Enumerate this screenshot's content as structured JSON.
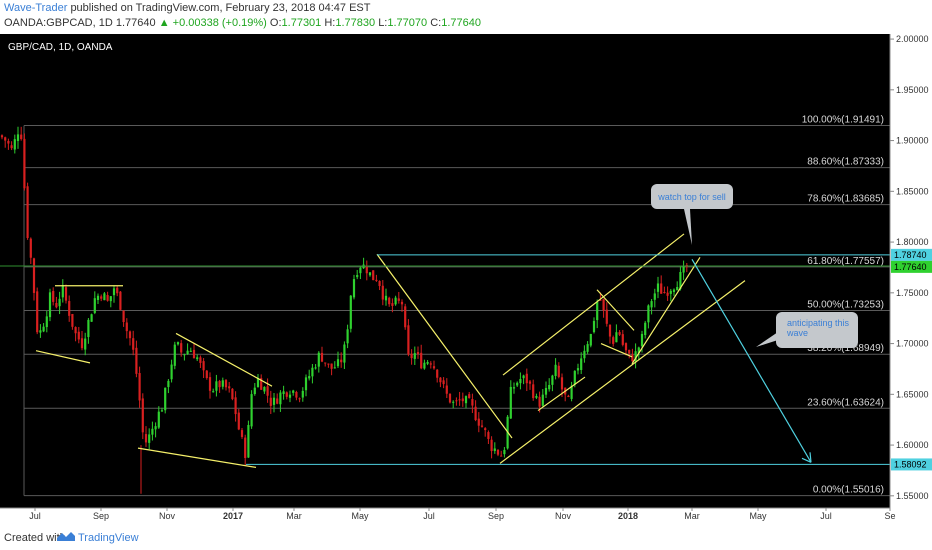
{
  "header": {
    "author": "Wave-Trader",
    "published": "published on TradingView.com, February 23, 2018 04:47 EST",
    "symbol": "OANDA:GBPCAD, 1D",
    "last": "1.77640",
    "change": "+0.00338 (+0.19%)",
    "o_label": "O:",
    "o_value": "1.77301",
    "h_label": "H:",
    "h_value": "1.77830",
    "l_label": "L:",
    "l_value": "1.77070",
    "c_label": "C:",
    "c_value": "1.77640"
  },
  "footer": {
    "created_with": "Created with",
    "brand": "TradingView"
  },
  "colors": {
    "bg": "#000000",
    "bull": "#2fd12f",
    "bear": "#d92020",
    "fib": "#5a5a5a",
    "trend": "#f5f06a",
    "cyan": "#4fd1e0",
    "note_bg": "#c4c8cc"
  },
  "chart_data": {
    "type": "candlestick",
    "symbol_label": "GBP/CAD, 1D, OANDA",
    "x_ticks": [
      "Jul",
      "Sep",
      "Nov",
      "2017",
      "Mar",
      "May",
      "Jul",
      "Sep",
      "Nov",
      "2018",
      "Mar",
      "May",
      "Jul",
      "Se"
    ],
    "y_ticks": [
      "2.00000",
      "1.95000",
      "1.90000",
      "1.85000",
      "1.80000",
      "1.75000",
      "1.70000",
      "1.65000",
      "1.60000",
      "1.55000"
    ],
    "ylim": [
      1.538,
      2.005
    ],
    "price_badges": [
      {
        "label": "1.78740",
        "value": 1.7874,
        "color": "#4fd1e0"
      },
      {
        "label": "1.77640",
        "value": 1.7764,
        "color": "#2fd12f"
      },
      {
        "label": "1.58092",
        "value": 1.58092,
        "color": "#4fd1e0"
      }
    ],
    "fib_levels": [
      {
        "label": "100.00%(1.91491)",
        "value": 1.91491
      },
      {
        "label": "88.60%(1.87333)",
        "value": 1.87333
      },
      {
        "label": "78.60%(1.83685)",
        "value": 1.83685
      },
      {
        "label": "61.80%(1.77557)",
        "value": 1.77557
      },
      {
        "label": "50.00%(1.73253)",
        "value": 1.73253
      },
      {
        "label": "38.20%(1.68949)",
        "value": 1.68949
      },
      {
        "label": "23.60%(1.63624)",
        "value": 1.63624
      },
      {
        "label": "0.00%(1.55016)",
        "value": 1.55016
      }
    ],
    "price_path": [
      [
        0,
        1.905
      ],
      [
        6,
        1.9
      ],
      [
        12,
        1.89
      ],
      [
        18,
        1.91
      ],
      [
        22,
        1.905
      ],
      [
        26,
        1.82
      ],
      [
        32,
        1.775
      ],
      [
        38,
        1.705
      ],
      [
        45,
        1.725
      ],
      [
        50,
        1.745
      ],
      [
        57,
        1.738
      ],
      [
        62,
        1.755
      ],
      [
        68,
        1.735
      ],
      [
        75,
        1.71
      ],
      [
        82,
        1.7
      ],
      [
        88,
        1.72
      ],
      [
        95,
        1.745
      ],
      [
        102,
        1.75
      ],
      [
        108,
        1.74
      ],
      [
        114,
        1.755
      ],
      [
        120,
        1.74
      ],
      [
        126,
        1.715
      ],
      [
        132,
        1.7
      ],
      [
        138,
        1.66
      ],
      [
        144,
        1.6
      ],
      [
        150,
        1.61
      ],
      [
        156,
        1.625
      ],
      [
        163,
        1.64
      ],
      [
        170,
        1.675
      ],
      [
        176,
        1.7
      ],
      [
        182,
        1.69
      ],
      [
        190,
        1.695
      ],
      [
        198,
        1.685
      ],
      [
        205,
        1.665
      ],
      [
        212,
        1.655
      ],
      [
        220,
        1.66
      ],
      [
        228,
        1.655
      ],
      [
        234,
        1.64
      ],
      [
        240,
        1.61
      ],
      [
        246,
        1.59
      ],
      [
        252,
        1.655
      ],
      [
        258,
        1.665
      ],
      [
        265,
        1.655
      ],
      [
        272,
        1.64
      ],
      [
        280,
        1.65
      ],
      [
        290,
        1.655
      ],
      [
        300,
        1.65
      ],
      [
        310,
        1.67
      ],
      [
        320,
        1.69
      ],
      [
        330,
        1.675
      ],
      [
        340,
        1.68
      ],
      [
        346,
        1.7
      ],
      [
        350,
        1.745
      ],
      [
        355,
        1.77
      ],
      [
        360,
        1.778
      ],
      [
        366,
        1.775
      ],
      [
        372,
        1.765
      ],
      [
        378,
        1.765
      ],
      [
        384,
        1.745
      ],
      [
        390,
        1.735
      ],
      [
        396,
        1.74
      ],
      [
        402,
        1.74
      ],
      [
        408,
        1.685
      ],
      [
        415,
        1.69
      ],
      [
        422,
        1.68
      ],
      [
        430,
        1.685
      ],
      [
        438,
        1.67
      ],
      [
        446,
        1.65
      ],
      [
        454,
        1.64
      ],
      [
        462,
        1.645
      ],
      [
        470,
        1.64
      ],
      [
        478,
        1.625
      ],
      [
        484,
        1.615
      ],
      [
        490,
        1.6
      ],
      [
        496,
        1.595
      ],
      [
        501,
        1.59
      ],
      [
        505,
        1.6
      ],
      [
        510,
        1.65
      ],
      [
        515,
        1.66
      ],
      [
        520,
        1.665
      ],
      [
        526,
        1.665
      ],
      [
        532,
        1.655
      ],
      [
        538,
        1.64
      ],
      [
        544,
        1.648
      ],
      [
        550,
        1.66
      ],
      [
        556,
        1.675
      ],
      [
        562,
        1.655
      ],
      [
        568,
        1.64
      ],
      [
        574,
        1.665
      ],
      [
        580,
        1.685
      ],
      [
        586,
        1.7
      ],
      [
        592,
        1.71
      ],
      [
        596,
        1.74
      ],
      [
        600,
        1.745
      ],
      [
        606,
        1.72
      ],
      [
        612,
        1.7
      ],
      [
        618,
        1.715
      ],
      [
        624,
        1.695
      ],
      [
        630,
        1.685
      ],
      [
        636,
        1.69
      ],
      [
        642,
        1.705
      ],
      [
        646,
        1.725
      ],
      [
        652,
        1.745
      ],
      [
        658,
        1.755
      ],
      [
        664,
        1.75
      ],
      [
        670,
        1.755
      ],
      [
        676,
        1.76
      ],
      [
        682,
        1.768
      ],
      [
        688,
        1.7764
      ]
    ],
    "annotations": [
      {
        "text": "watch top for sell"
      },
      {
        "text": "anticipating this wave"
      }
    ]
  }
}
